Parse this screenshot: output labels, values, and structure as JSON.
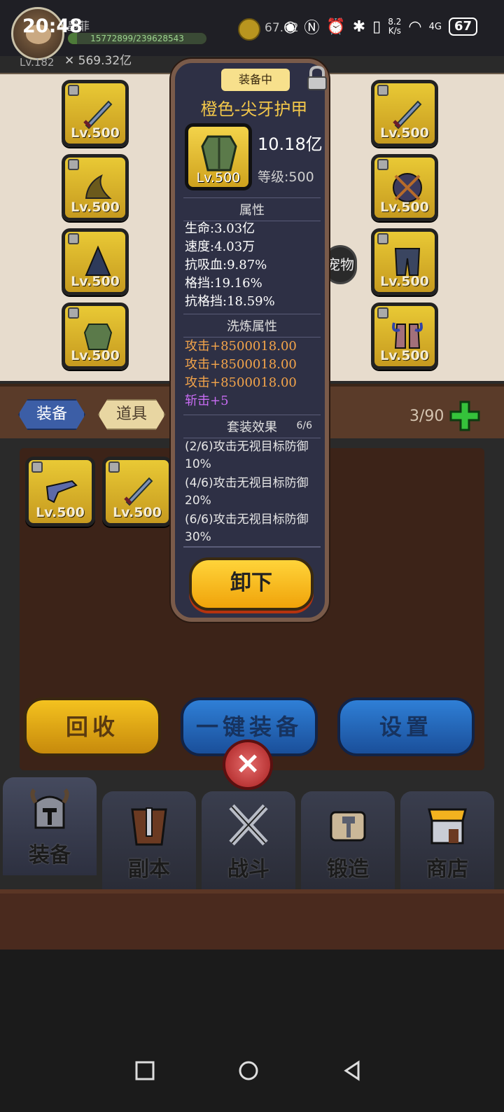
{
  "status_bar": {
    "time": "20:48",
    "network_speed_top": "8.2",
    "network_speed_bottom": "K/s",
    "signal": "4G",
    "battery": "67"
  },
  "player": {
    "name": "墨菲",
    "exp_text": "15772899/239628543",
    "exp_fraction": 0.066,
    "level": "Lv.182",
    "combat_power": "569.32亿",
    "coins": "67.62"
  },
  "equipment_slots": [
    {
      "level": "Lv.500"
    },
    {
      "level": "Lv.500"
    },
    {
      "level": "Lv.500"
    },
    {
      "level": "Lv.500"
    },
    {
      "level": "Lv.500"
    },
    {
      "level": "Lv.500"
    },
    {
      "level": "Lv.500"
    },
    {
      "level": "Lv.500"
    }
  ],
  "center_badge": "宠物",
  "tabs": {
    "equip": "装备",
    "item": "道具",
    "count": "3/90"
  },
  "inventory": [
    {
      "level": "Lv.500"
    },
    {
      "level": "Lv.500"
    }
  ],
  "actions": {
    "recycle": "回收",
    "equip_all": "一键装备",
    "settings": "设置"
  },
  "bottom_nav": [
    {
      "label": "装备"
    },
    {
      "label": "副本"
    },
    {
      "label": "战斗"
    },
    {
      "label": "锻造"
    },
    {
      "label": "商店"
    }
  ],
  "popup": {
    "tag": "装备中",
    "title": "橙色-尖牙护甲",
    "item_level": "Lv.500",
    "power": "10.18亿",
    "grade": "等级:500",
    "attributes_header": "属性",
    "attributes": [
      "生命:3.03亿",
      "速度:4.03万",
      "抗吸血:9.87%",
      "格挡:19.16%",
      "抗格挡:18.59%"
    ],
    "refine_header": "洗炼属性",
    "refine_orange": [
      "攻击+8500018.00",
      "攻击+8500018.00",
      "攻击+8500018.00"
    ],
    "refine_purple": "斩击+5",
    "set_header": "套装效果",
    "set_count": "6/6",
    "set_effects": [
      "(2/6)攻击无视目标防御10%",
      "(4/6)攻击无视目标防御20%",
      "(6/6)攻击无视目标防御30%"
    ],
    "unequip_label": "卸下"
  }
}
